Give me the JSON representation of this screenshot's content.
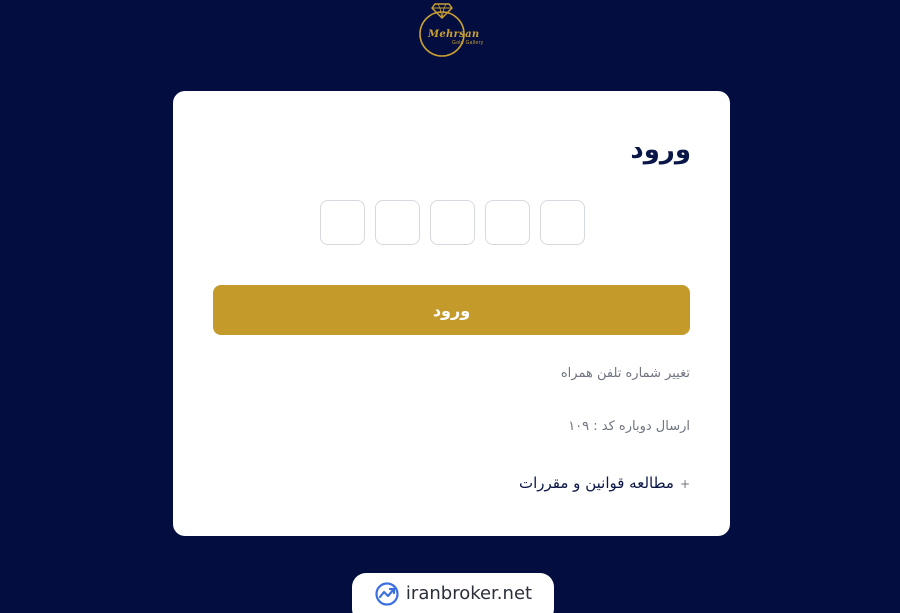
{
  "logo": {
    "name": "Mehrsan",
    "subtitle": "Gold Gallery",
    "icon": "diamond-ring-icon",
    "color": "#c9a032"
  },
  "login": {
    "title": "ورود",
    "otp_values": [
      "",
      "",
      "",
      "",
      ""
    ],
    "submit_label": "ورود",
    "change_phone_label": "تغییر شماره تلفن همراه",
    "resend_text": "ارسال دوباره کد : ۱۰۹",
    "terms_plus": "+",
    "terms_label": "مطالعه قوانین و مقررات"
  },
  "badge": {
    "icon": "chart-trend-icon",
    "text": "iranbroker.net"
  },
  "colors": {
    "background": "#030d3f",
    "card": "#ffffff",
    "accent": "#c49a2b",
    "title": "#0b1648",
    "muted": "#707580"
  }
}
